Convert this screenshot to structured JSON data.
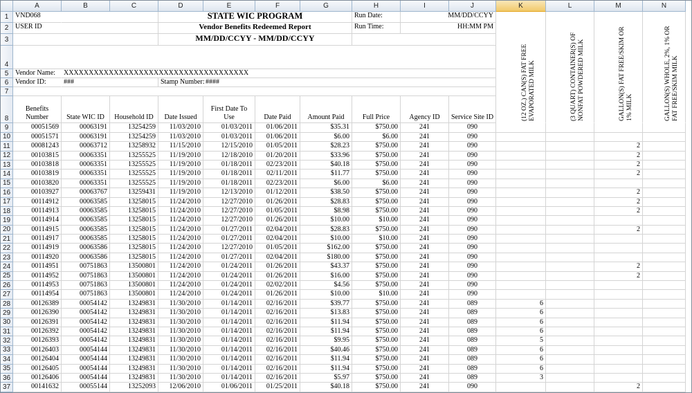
{
  "columns": [
    "A",
    "B",
    "C",
    "D",
    "E",
    "F",
    "G",
    "H",
    "I",
    "J",
    "K",
    "L",
    "M",
    "N"
  ],
  "selected_column": "K",
  "header": {
    "vendor_code": "VND068",
    "user_id": "USER ID",
    "title": "STATE WIC PROGRAM",
    "subtitle": "Vendor Benefits Redeemed Report",
    "date_range": "MM/DD/CCYY - MM/DD/CCYY",
    "run_date_label": "Run Date:",
    "run_date_value": "MM/DD/CCYY",
    "run_time_label": "Run Time:",
    "run_time_value": "HH:MM PM",
    "vendor_name_label": "Vendor Name:",
    "vendor_name_value": "XXXXXXXXXXXXXXXXXXXXXXXXXXXXXXXXXXXXX",
    "vendor_id_label": "Vendor ID:",
    "vendor_id_value": "###",
    "stamp_label": "Stamp Number:",
    "stamp_value": "####"
  },
  "table_headers": {
    "benefits_number": "Benefits Number",
    "state_wic_id": "State WIC ID",
    "household_id": "Household ID",
    "date_issued": "Date Issued",
    "first_date": "First Date To Use",
    "date_paid": "Date Paid",
    "amount_paid": "Amount Paid",
    "full_price": "Full Price",
    "agency_id": "Agency ID",
    "service_site_id": "Service Site ID",
    "k": "(12 OZ.) CAN(S) FAT FREE EVAPORATED MILK",
    "l": "(3 QUART) CONTAINER(S) OF NONFAT POWDERED MILK",
    "m": "GALLON(S) FAT FREE/SKIM OR 1% MILK",
    "n": "GALLON(S) WHOLE, 2%, 1% OR FAT FREE/SKIM MILK"
  },
  "rows": [
    {
      "n": "9",
      "b": "00051569",
      "s": "00063191",
      "h": "13254259",
      "di": "11/03/2010",
      "fd": "01/03/2011",
      "dp": "01/06/2011",
      "ap": "$35.31",
      "fp": "$750.00",
      "ag": "241",
      "ss": "090",
      "k": "",
      "m": ""
    },
    {
      "n": "10",
      "b": "00051571",
      "s": "00063191",
      "h": "13254259",
      "di": "11/03/2010",
      "fd": "01/03/2011",
      "dp": "01/06/2011",
      "ap": "$6.00",
      "fp": "$6.00",
      "ag": "241",
      "ss": "090",
      "k": "",
      "m": ""
    },
    {
      "n": "11",
      "b": "00081243",
      "s": "00063712",
      "h": "13258932",
      "di": "11/15/2010",
      "fd": "12/15/2010",
      "dp": "01/05/2011",
      "ap": "$28.23",
      "fp": "$750.00",
      "ag": "241",
      "ss": "090",
      "k": "",
      "m": "2"
    },
    {
      "n": "12",
      "b": "00103815",
      "s": "00063351",
      "h": "13255525",
      "di": "11/19/2010",
      "fd": "12/18/2010",
      "dp": "01/20/2011",
      "ap": "$33.96",
      "fp": "$750.00",
      "ag": "241",
      "ss": "090",
      "k": "",
      "m": "2"
    },
    {
      "n": "13",
      "b": "00103818",
      "s": "00063351",
      "h": "13255525",
      "di": "11/19/2010",
      "fd": "01/18/2011",
      "dp": "02/23/2011",
      "ap": "$40.18",
      "fp": "$750.00",
      "ag": "241",
      "ss": "090",
      "k": "",
      "m": "2"
    },
    {
      "n": "14",
      "b": "00103819",
      "s": "00063351",
      "h": "13255525",
      "di": "11/19/2010",
      "fd": "01/18/2011",
      "dp": "02/11/2011",
      "ap": "$11.77",
      "fp": "$750.00",
      "ag": "241",
      "ss": "090",
      "k": "",
      "m": "2"
    },
    {
      "n": "15",
      "b": "00103820",
      "s": "00063351",
      "h": "13255525",
      "di": "11/19/2010",
      "fd": "01/18/2011",
      "dp": "02/23/2011",
      "ap": "$6.00",
      "fp": "$6.00",
      "ag": "241",
      "ss": "090",
      "k": "",
      "m": ""
    },
    {
      "n": "16",
      "b": "00103927",
      "s": "00063767",
      "h": "13259431",
      "di": "11/19/2010",
      "fd": "12/13/2010",
      "dp": "01/12/2011",
      "ap": "$38.50",
      "fp": "$750.00",
      "ag": "241",
      "ss": "090",
      "k": "",
      "m": "2"
    },
    {
      "n": "17",
      "b": "00114912",
      "s": "00063585",
      "h": "13258015",
      "di": "11/24/2010",
      "fd": "12/27/2010",
      "dp": "01/26/2011",
      "ap": "$28.83",
      "fp": "$750.00",
      "ag": "241",
      "ss": "090",
      "k": "",
      "m": "2"
    },
    {
      "n": "18",
      "b": "00114913",
      "s": "00063585",
      "h": "13258015",
      "di": "11/24/2010",
      "fd": "12/27/2010",
      "dp": "01/05/2011",
      "ap": "$8.98",
      "fp": "$750.00",
      "ag": "241",
      "ss": "090",
      "k": "",
      "m": "2"
    },
    {
      "n": "19",
      "b": "00114914",
      "s": "00063585",
      "h": "13258015",
      "di": "11/24/2010",
      "fd": "12/27/2010",
      "dp": "01/26/2011",
      "ap": "$10.00",
      "fp": "$10.00",
      "ag": "241",
      "ss": "090",
      "k": "",
      "m": ""
    },
    {
      "n": "20",
      "b": "00114915",
      "s": "00063585",
      "h": "13258015",
      "di": "11/24/2010",
      "fd": "01/27/2011",
      "dp": "02/04/2011",
      "ap": "$28.83",
      "fp": "$750.00",
      "ag": "241",
      "ss": "090",
      "k": "",
      "m": "2"
    },
    {
      "n": "21",
      "b": "00114917",
      "s": "00063585",
      "h": "13258015",
      "di": "11/24/2010",
      "fd": "01/27/2011",
      "dp": "02/04/2011",
      "ap": "$10.00",
      "fp": "$10.00",
      "ag": "241",
      "ss": "090",
      "k": "",
      "m": ""
    },
    {
      "n": "22",
      "b": "00114919",
      "s": "00063586",
      "h": "13258015",
      "di": "11/24/2010",
      "fd": "12/27/2010",
      "dp": "01/05/2011",
      "ap": "$162.00",
      "fp": "$750.00",
      "ag": "241",
      "ss": "090",
      "k": "",
      "m": ""
    },
    {
      "n": "23",
      "b": "00114920",
      "s": "00063586",
      "h": "13258015",
      "di": "11/24/2010",
      "fd": "01/27/2011",
      "dp": "02/04/2011",
      "ap": "$180.00",
      "fp": "$750.00",
      "ag": "241",
      "ss": "090",
      "k": "",
      "m": ""
    },
    {
      "n": "24",
      "b": "00114951",
      "s": "00751863",
      "h": "13500801",
      "di": "11/24/2010",
      "fd": "01/24/2011",
      "dp": "01/26/2011",
      "ap": "$43.37",
      "fp": "$750.00",
      "ag": "241",
      "ss": "090",
      "k": "",
      "m": "2"
    },
    {
      "n": "25",
      "b": "00114952",
      "s": "00751863",
      "h": "13500801",
      "di": "11/24/2010",
      "fd": "01/24/2011",
      "dp": "01/26/2011",
      "ap": "$16.00",
      "fp": "$750.00",
      "ag": "241",
      "ss": "090",
      "k": "",
      "m": "2"
    },
    {
      "n": "26",
      "b": "00114953",
      "s": "00751863",
      "h": "13500801",
      "di": "11/24/2010",
      "fd": "01/24/2011",
      "dp": "02/02/2011",
      "ap": "$4.56",
      "fp": "$750.00",
      "ag": "241",
      "ss": "090",
      "k": "",
      "m": ""
    },
    {
      "n": "27",
      "b": "00114954",
      "s": "00751863",
      "h": "13500801",
      "di": "11/24/2010",
      "fd": "01/24/2011",
      "dp": "01/26/2011",
      "ap": "$10.00",
      "fp": "$10.00",
      "ag": "241",
      "ss": "090",
      "k": "",
      "m": ""
    },
    {
      "n": "28",
      "b": "00126389",
      "s": "00054142",
      "h": "13249831",
      "di": "11/30/2010",
      "fd": "01/14/2011",
      "dp": "02/16/2011",
      "ap": "$39.77",
      "fp": "$750.00",
      "ag": "241",
      "ss": "089",
      "k": "6",
      "m": ""
    },
    {
      "n": "29",
      "b": "00126390",
      "s": "00054142",
      "h": "13249831",
      "di": "11/30/2010",
      "fd": "01/14/2011",
      "dp": "02/16/2011",
      "ap": "$13.83",
      "fp": "$750.00",
      "ag": "241",
      "ss": "089",
      "k": "6",
      "m": ""
    },
    {
      "n": "30",
      "b": "00126391",
      "s": "00054142",
      "h": "13249831",
      "di": "11/30/2010",
      "fd": "01/14/2011",
      "dp": "02/16/2011",
      "ap": "$11.94",
      "fp": "$750.00",
      "ag": "241",
      "ss": "089",
      "k": "6",
      "m": ""
    },
    {
      "n": "31",
      "b": "00126392",
      "s": "00054142",
      "h": "13249831",
      "di": "11/30/2010",
      "fd": "01/14/2011",
      "dp": "02/16/2011",
      "ap": "$11.94",
      "fp": "$750.00",
      "ag": "241",
      "ss": "089",
      "k": "6",
      "m": ""
    },
    {
      "n": "32",
      "b": "00126393",
      "s": "00054142",
      "h": "13249831",
      "di": "11/30/2010",
      "fd": "01/14/2011",
      "dp": "02/16/2011",
      "ap": "$9.95",
      "fp": "$750.00",
      "ag": "241",
      "ss": "089",
      "k": "5",
      "m": ""
    },
    {
      "n": "33",
      "b": "00126403",
      "s": "00054144",
      "h": "13249831",
      "di": "11/30/2010",
      "fd": "01/14/2011",
      "dp": "02/16/2011",
      "ap": "$40.46",
      "fp": "$750.00",
      "ag": "241",
      "ss": "089",
      "k": "6",
      "m": ""
    },
    {
      "n": "34",
      "b": "00126404",
      "s": "00054144",
      "h": "13249831",
      "di": "11/30/2010",
      "fd": "01/14/2011",
      "dp": "02/16/2011",
      "ap": "$11.94",
      "fp": "$750.00",
      "ag": "241",
      "ss": "089",
      "k": "6",
      "m": ""
    },
    {
      "n": "35",
      "b": "00126405",
      "s": "00054144",
      "h": "13249831",
      "di": "11/30/2010",
      "fd": "01/14/2011",
      "dp": "02/16/2011",
      "ap": "$11.94",
      "fp": "$750.00",
      "ag": "241",
      "ss": "089",
      "k": "6",
      "m": ""
    },
    {
      "n": "36",
      "b": "00126406",
      "s": "00054144",
      "h": "13249831",
      "di": "11/30/2010",
      "fd": "01/14/2011",
      "dp": "02/16/2011",
      "ap": "$5.97",
      "fp": "$750.00",
      "ag": "241",
      "ss": "089",
      "k": "3",
      "m": ""
    },
    {
      "n": "37",
      "b": "00141632",
      "s": "00055144",
      "h": "13252093",
      "di": "12/06/2010",
      "fd": "01/06/2011",
      "dp": "01/25/2011",
      "ap": "$40.18",
      "fp": "$750.00",
      "ag": "241",
      "ss": "090",
      "k": "",
      "m": "2"
    },
    {
      "n": "38",
      "b": "00141633",
      "s": "00055144",
      "h": "13252093",
      "di": "12/06/2010",
      "fd": "01/06/2011",
      "dp": "02/01/2011",
      "ap": "$15.96",
      "fp": "$750.00",
      "ag": "241",
      "ss": "090",
      "k": "",
      "m": "2"
    }
  ]
}
